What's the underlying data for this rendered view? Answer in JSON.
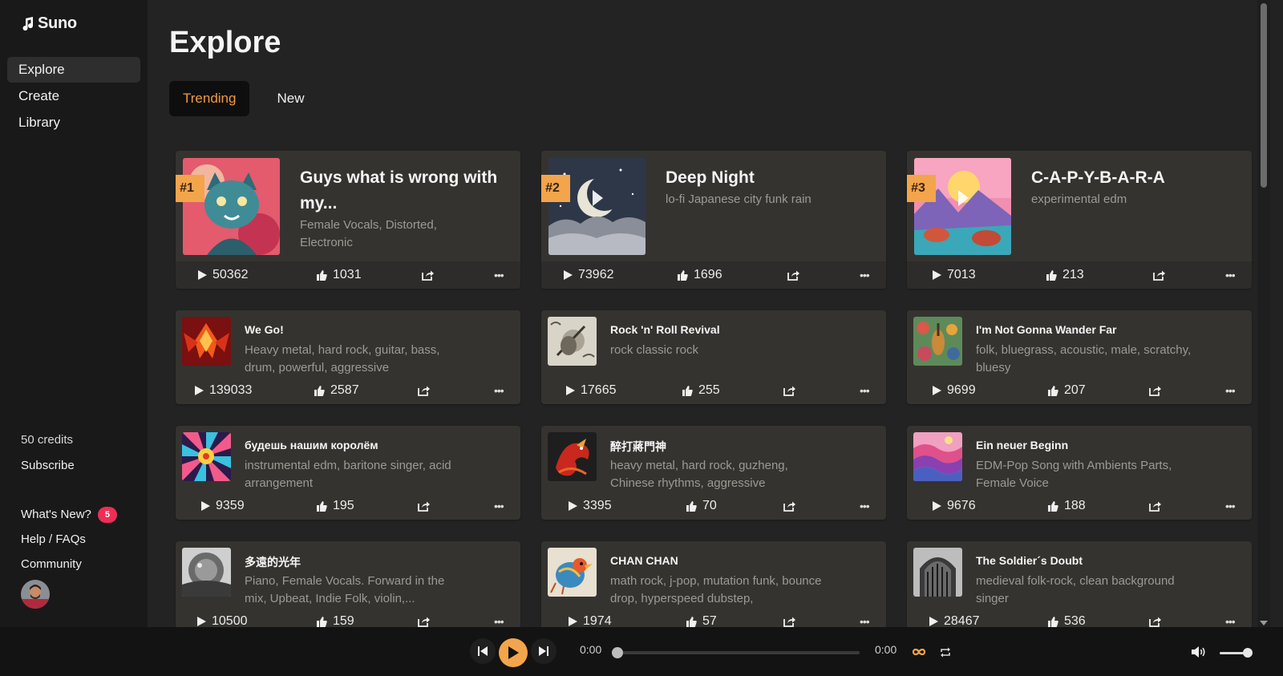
{
  "app": {
    "name": "Suno"
  },
  "sidebar": {
    "items": [
      {
        "label": "Explore",
        "active": true
      },
      {
        "label": "Create"
      },
      {
        "label": "Library"
      }
    ],
    "credits": "50 credits",
    "subscribe": "Subscribe",
    "whats_new": "What's New?",
    "whats_new_count": "5",
    "help": "Help / FAQs",
    "community": "Community"
  },
  "page": {
    "title": "Explore",
    "tabs": [
      {
        "label": "Trending",
        "active": true
      },
      {
        "label": "New"
      }
    ]
  },
  "featured": [
    {
      "rank": "#1",
      "title": "Guys what is wrong with my...",
      "tags": "Female Vocals, Distorted, Electronic",
      "plays": "50362",
      "likes": "1031"
    },
    {
      "rank": "#2",
      "title": "Deep Night",
      "tags": "lo-fi Japanese city funk rain",
      "plays": "73962",
      "likes": "1696"
    },
    {
      "rank": "#3",
      "title": "C-A-P-Y-B-A-R-A",
      "tags": "experimental edm",
      "plays": "7013",
      "likes": "213"
    }
  ],
  "songs": [
    {
      "title": "We Go!",
      "tags": "Heavy metal, hard rock, guitar, bass, drum, powerful, aggressive",
      "plays": "139033",
      "likes": "2587"
    },
    {
      "title": "Rock 'n' Roll Revival",
      "tags": "rock classic rock",
      "plays": "17665",
      "likes": "255"
    },
    {
      "title": "I'm Not Gonna Wander Far",
      "tags": "folk, bluegrass, acoustic, male, scratchy, bluesy",
      "plays": "9699",
      "likes": "207"
    },
    {
      "title": "будешь нашим королём",
      "tags": "instrumental edm, baritone singer, acid arrangement",
      "plays": "9359",
      "likes": "195"
    },
    {
      "title": "醉打蔣門神",
      "tags": "heavy metal, hard rock, guzheng, Chinese rhythms, aggressive",
      "plays": "3395",
      "likes": "70"
    },
    {
      "title": "Ein neuer Beginn",
      "tags": "EDM-Pop Song with Ambients Parts, Female Voice",
      "plays": "9676",
      "likes": "188"
    },
    {
      "title": "多遠的光年",
      "tags": "Piano, Female Vocals. Forward in the mix, Upbeat, Indie Folk, violin,...",
      "plays": "10500",
      "likes": "159"
    },
    {
      "title": "CHAN CHAN",
      "tags": "math rock, j-pop, mutation funk, bounce drop, hyperspeed dubstep,",
      "plays": "1974",
      "likes": "57"
    },
    {
      "title": "The Soldier´s Doubt",
      "tags": "medieval folk-rock, clean background singer",
      "plays": "28467",
      "likes": "536"
    }
  ],
  "player": {
    "current_time": "0:00",
    "duration": "0:00",
    "progress": 0,
    "volume": 0.85
  },
  "colors": {
    "accent": "#f3a54b",
    "tab_active_text": "#f29a3c",
    "badge": "#ef2d56"
  },
  "icons": {
    "play": "play-icon",
    "like": "thumbs-up-icon",
    "share": "share-icon",
    "more": "more-icon",
    "prev": "skip-back-icon",
    "next": "skip-forward-icon",
    "loop": "infinity-icon",
    "repeat": "repeat-icon",
    "volume": "volume-icon"
  }
}
